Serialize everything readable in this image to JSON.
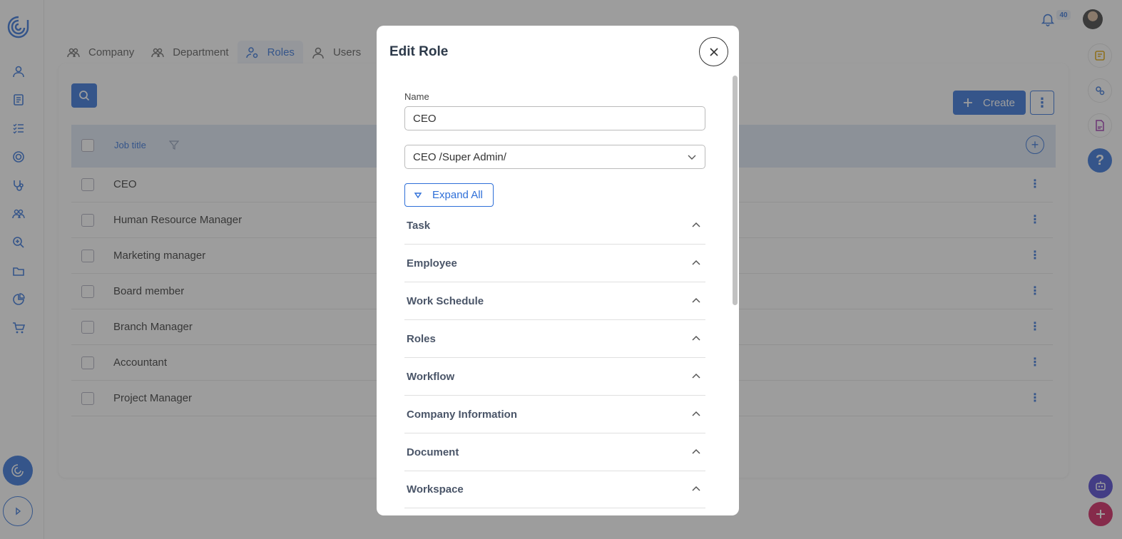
{
  "notifications": {
    "count": "40"
  },
  "tabs": [
    {
      "label": "Company"
    },
    {
      "label": "Department"
    },
    {
      "label": "Roles"
    },
    {
      "label": "Users"
    }
  ],
  "toolbar": {
    "create_label": "Create"
  },
  "table": {
    "header": {
      "job_title": "Job title"
    },
    "rows": [
      {
        "title": "CEO"
      },
      {
        "title": "Human Resource Manager"
      },
      {
        "title": "Marketing manager"
      },
      {
        "title": "Board member"
      },
      {
        "title": "Branch Manager"
      },
      {
        "title": "Accountant"
      },
      {
        "title": "Project Manager"
      }
    ]
  },
  "modal": {
    "title": "Edit Role",
    "name_label": "Name",
    "name_value": "CEO",
    "role_select_value": "CEO /Super Admin/",
    "expand_all_label": "Expand All",
    "sections": [
      {
        "label": "Task"
      },
      {
        "label": "Employee"
      },
      {
        "label": "Work Schedule"
      },
      {
        "label": "Roles"
      },
      {
        "label": "Workflow"
      },
      {
        "label": "Company Information"
      },
      {
        "label": "Document"
      },
      {
        "label": "Workspace"
      }
    ]
  },
  "help": {
    "label": "?"
  },
  "colors": {
    "primary": "#2e6fd8",
    "fab": "#d11a5a",
    "ai": "#4a3fcf"
  }
}
